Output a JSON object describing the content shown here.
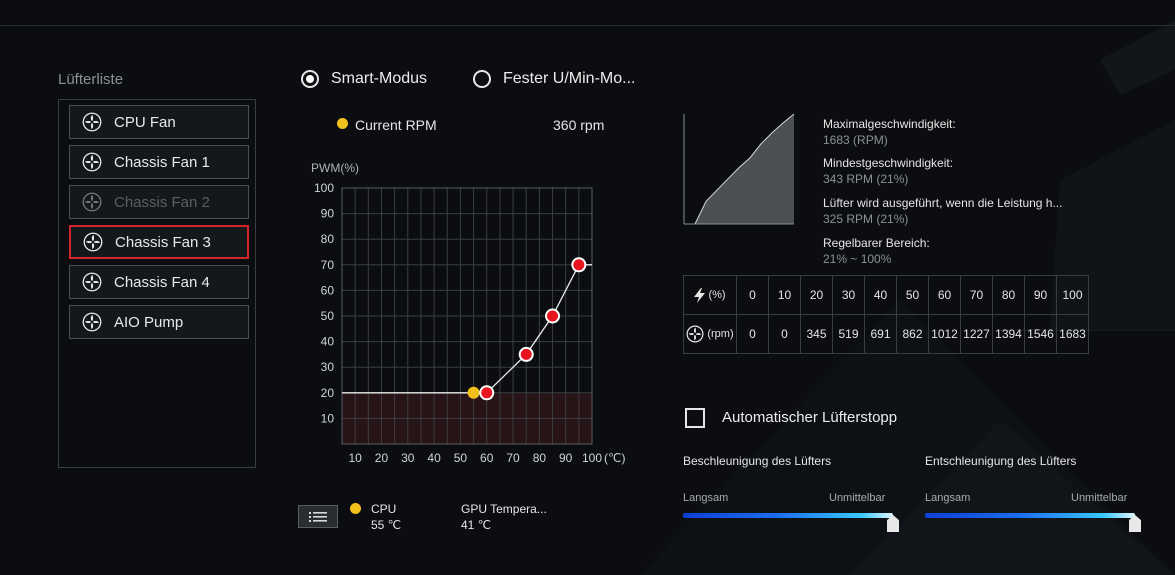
{
  "fan_list": {
    "title": "Lüfterliste",
    "items": [
      {
        "label": "CPU Fan",
        "state": "normal"
      },
      {
        "label": "Chassis Fan 1",
        "state": "normal"
      },
      {
        "label": "Chassis Fan 2",
        "state": "disabled"
      },
      {
        "label": "Chassis Fan 3",
        "state": "selected"
      },
      {
        "label": "Chassis Fan 4",
        "state": "normal"
      },
      {
        "label": "AIO Pump",
        "state": "normal"
      }
    ]
  },
  "modes": {
    "smart": "Smart-Modus",
    "fixed": "Fester U/Min-Mo...",
    "selected": "smart"
  },
  "current": {
    "label": "Current RPM",
    "value": "360 rpm",
    "dot_color": "#f2c01d"
  },
  "chart_data": {
    "type": "line",
    "ylabel": "PWM(%)",
    "xunit": "(℃)",
    "x_ticks": [
      10,
      20,
      30,
      40,
      50,
      60,
      70,
      80,
      90,
      100
    ],
    "y_ticks": [
      10,
      20,
      30,
      40,
      50,
      60,
      70,
      80,
      90,
      100
    ],
    "xlim": [
      5,
      100
    ],
    "ylim": [
      0,
      100
    ],
    "grid": true,
    "series": [
      {
        "points": [
          [
            60,
            20
          ],
          [
            75,
            35
          ],
          [
            85,
            50
          ],
          [
            95,
            70
          ]
        ],
        "color": "#e8141e"
      }
    ],
    "current_point": {
      "x": 55,
      "y": 20,
      "color": "#f2c01d"
    },
    "floor_pwm": 20
  },
  "temps": [
    {
      "name": "CPU",
      "value": "55 ℃",
      "dot": true
    },
    {
      "name": "GPU Tempera...",
      "value": "41 ℃",
      "dot": false
    }
  ],
  "info": {
    "max_label": "Maximalgeschwindigkeit:",
    "max_value": "1683 (RPM)",
    "min_label": "Mindestgeschwindigkeit:",
    "min_value": "343 RPM (21%)",
    "run_label": "Lüfter wird ausgeführt, wenn die Leistung h...",
    "run_value": "325 RPM (21%)",
    "range_label": "Regelbarer Bereich:",
    "range_value": "21% ~ 100%"
  },
  "mini_curve": {
    "pwm": [
      0,
      10,
      20,
      30,
      40,
      50,
      60,
      70,
      80,
      90,
      100
    ],
    "rpm": [
      0,
      0,
      345,
      519,
      691,
      862,
      1012,
      1227,
      1394,
      1546,
      1683
    ]
  },
  "table": {
    "pct_unit": "(%)",
    "rpm_unit": "(rpm)",
    "pct": [
      "0",
      "10",
      "20",
      "30",
      "40",
      "50",
      "60",
      "70",
      "80",
      "90",
      "100"
    ],
    "rpm": [
      "0",
      "0",
      "345",
      "519",
      "691",
      "862",
      "1012",
      "1227",
      "1394",
      "1546",
      "1683"
    ]
  },
  "auto_stop": {
    "label": "Automatischer Lüfterstopp",
    "checked": false
  },
  "accel": {
    "title": "Beschleunigung des Lüfters",
    "left": "Langsam",
    "right": "Unmittelbar",
    "value": 1.0
  },
  "decel": {
    "title": "Entschleunigung des Lüfters",
    "left": "Langsam",
    "right": "Unmittelbar",
    "value": 1.0
  }
}
